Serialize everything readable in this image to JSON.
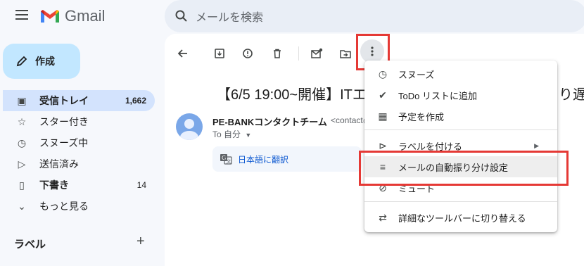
{
  "app": {
    "name": "Gmail"
  },
  "search": {
    "placeholder": "メールを検索"
  },
  "compose": {
    "label": "作成"
  },
  "sidebar": {
    "items": [
      {
        "label": "受信トレイ",
        "count": "1,662",
        "icon": "inbox-icon",
        "active": true
      },
      {
        "label": "スター付き",
        "count": "",
        "icon": "star-icon"
      },
      {
        "label": "スヌーズ中",
        "count": "",
        "icon": "clock-icon"
      },
      {
        "label": "送信済み",
        "count": "",
        "icon": "send-icon"
      },
      {
        "label": "下書き",
        "count": "14",
        "icon": "draft-icon"
      },
      {
        "label": "もっと見る",
        "count": "",
        "icon": "chevron-down-icon"
      }
    ],
    "labels_title": "ラベル"
  },
  "email": {
    "subject": "【6/5 19:00~開催】ITエ",
    "subject_tail": "り遅れ",
    "sender_name": "PE-BANKコンタクトチーム",
    "sender_email": "<contact@",
    "to": "To 自分",
    "translate_label": "日本語に翻訳"
  },
  "menu": {
    "items": [
      {
        "label": "スヌーズ",
        "icon": "clock-icon"
      },
      {
        "label": "ToDo リストに追加",
        "icon": "task-add-icon"
      },
      {
        "label": "予定を作成",
        "icon": "calendar-icon"
      },
      {
        "label": "ラベルを付ける",
        "icon": "label-icon",
        "submenu": true
      },
      {
        "label": "メールの自動振り分け設定",
        "icon": "filter-icon",
        "highlighted": true
      },
      {
        "label": "ミュート",
        "icon": "mute-icon"
      },
      {
        "label": "詳細なツールバーに切り替える",
        "icon": "swap-icon"
      }
    ]
  },
  "colors": {
    "accent": "#c2e7ff",
    "active_nav": "#d3e3fd",
    "highlight_box": "#e53935",
    "link": "#0b57d0"
  }
}
